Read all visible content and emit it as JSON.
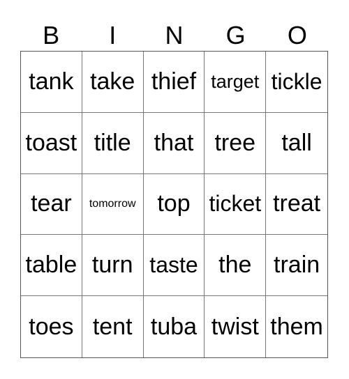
{
  "header": [
    "B",
    "I",
    "N",
    "G",
    "O"
  ],
  "cells": [
    {
      "word": "tank",
      "size": ""
    },
    {
      "word": "take",
      "size": ""
    },
    {
      "word": "thief",
      "size": ""
    },
    {
      "word": "target",
      "size": "sm"
    },
    {
      "word": "tickle",
      "size": "md"
    },
    {
      "word": "toast",
      "size": ""
    },
    {
      "word": "title",
      "size": ""
    },
    {
      "word": "that",
      "size": ""
    },
    {
      "word": "tree",
      "size": ""
    },
    {
      "word": "tall",
      "size": ""
    },
    {
      "word": "tear",
      "size": ""
    },
    {
      "word": "tomorrow",
      "size": "xs"
    },
    {
      "word": "top",
      "size": ""
    },
    {
      "word": "ticket",
      "size": "md"
    },
    {
      "word": "treat",
      "size": ""
    },
    {
      "word": "table",
      "size": ""
    },
    {
      "word": "turn",
      "size": ""
    },
    {
      "word": "taste",
      "size": "md"
    },
    {
      "word": "the",
      "size": ""
    },
    {
      "word": "train",
      "size": ""
    },
    {
      "word": "toes",
      "size": ""
    },
    {
      "word": "tent",
      "size": ""
    },
    {
      "word": "tuba",
      "size": ""
    },
    {
      "word": "twist",
      "size": ""
    },
    {
      "word": "them",
      "size": ""
    }
  ]
}
